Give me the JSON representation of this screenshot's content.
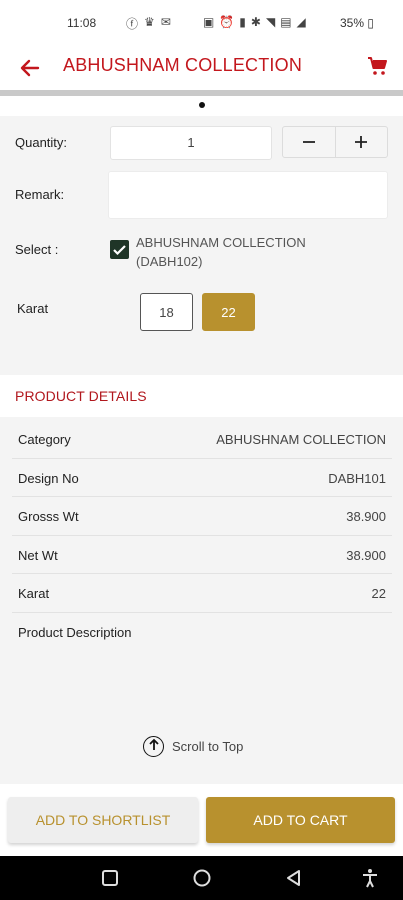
{
  "status_bar": {
    "time": "11:08",
    "battery": "35%"
  },
  "app_bar": {
    "title": "ABHUSHNAM COLLECTION"
  },
  "form": {
    "quantity_label": "Quantity:",
    "quantity_value": "1",
    "remark_label": "Remark:",
    "remark_value": "",
    "select_label": "Select :",
    "select_option": "ABHUSHNAM COLLECTION (DABH102)",
    "select_checked": true,
    "karat_label": "Karat",
    "karat_options": [
      "18",
      "22"
    ],
    "karat_selected": "22"
  },
  "product_details": {
    "title": "PRODUCT DETAILS",
    "rows": [
      {
        "label": "Category",
        "value": "ABHUSHNAM COLLECTION"
      },
      {
        "label": "Design No",
        "value": "DABH101"
      },
      {
        "label": "Grosss Wt",
        "value": "38.900"
      },
      {
        "label": "Net Wt",
        "value": "38.900"
      },
      {
        "label": "Karat",
        "value": "22"
      },
      {
        "label": "Product Description",
        "value": ""
      }
    ]
  },
  "scroll_top_label": "Scroll to Top",
  "actions": {
    "shortlist_label": "ADD TO SHORTLIST",
    "cart_label": "ADD TO CART"
  },
  "colors": {
    "brand_red": "#c3171d",
    "gold": "#b8912e"
  },
  "icons": {
    "back": "arrow-left-icon",
    "cart": "cart-icon",
    "scroll_top": "arrow-up-circle-icon",
    "nav_recents": "square-icon",
    "nav_home": "circle-icon",
    "nav_back": "triangle-back-icon",
    "nav_accessibility": "accessibility-icon"
  }
}
